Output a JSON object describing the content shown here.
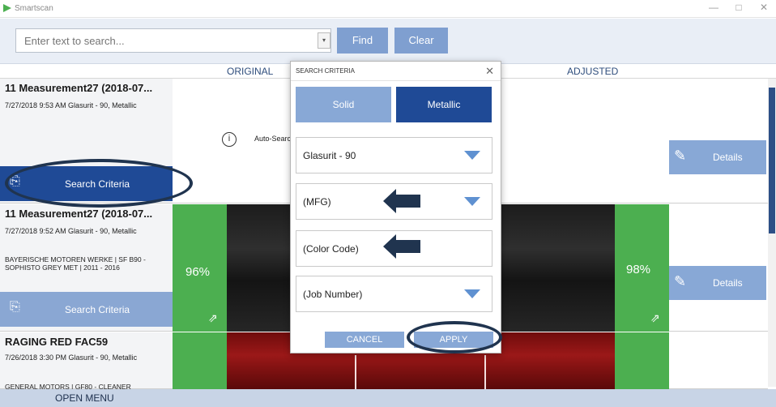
{
  "app": {
    "title": "Smartscan",
    "minimize": "—",
    "restore": "□",
    "close": "✕"
  },
  "search": {
    "placeholder": "Enter text to search...",
    "find_label": "Find",
    "clear_label": "Clear"
  },
  "columns": {
    "original": "ORIGINAL",
    "adjusted": "ADJUSTED"
  },
  "rows": [
    {
      "title": "11 Measurement27 (2018-07...",
      "meta": "7/27/2018 9:53 AM  Glasurit - 90, Metallic",
      "auto_search": "Auto-Searc",
      "criteria_label": "Search Criteria",
      "details_label": "Details"
    },
    {
      "title": "11 Measurement27 (2018-07...",
      "meta": "7/27/2018 9:52 AM  Glasurit - 90, Metallic",
      "desc": "BAYERISCHE MOTOREN WERKE  |  SF B90  - SOPHISTO GREY MET  |  2011 - 2016",
      "orig_pct": "96%",
      "adj_pct": "98%",
      "criteria_label": "Search Criteria",
      "details_label": "Details"
    },
    {
      "title": "RAGING RED FAC59",
      "meta": "7/26/2018 3:30 PM  Glasurit - 90, Metallic",
      "desc": "GENERAL MOTORS  |  GF80 - CLEANER"
    }
  ],
  "dialog": {
    "title": "SEARCH CRITERIA",
    "close": "✕",
    "solid_label": "Solid",
    "metallic_label": "Metallic",
    "paint_system": "Glasurit - 90",
    "mfg_placeholder": "(MFG)",
    "color_code_placeholder": "(Color Code)",
    "job_number_placeholder": "(Job Number)",
    "cancel_label": "CANCEL",
    "apply_label": "APPLY"
  },
  "footer": {
    "open_menu": "OPEN MENU"
  },
  "colors": {
    "accent": "#2c4f86",
    "button": "#88a8d6",
    "green": "#4caf50",
    "annotation": "#20344f"
  }
}
